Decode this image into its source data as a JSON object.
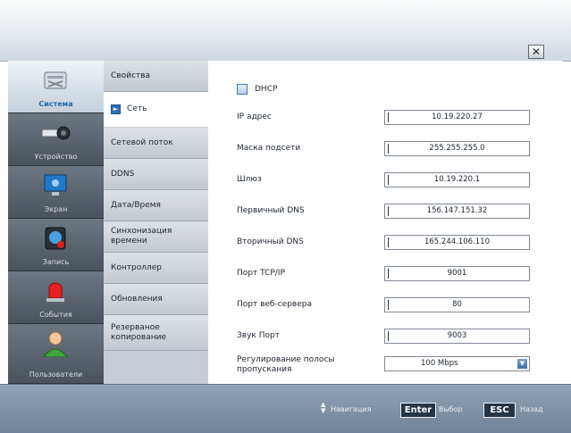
{
  "window": {
    "close_glyph": "✕"
  },
  "sidebar": {
    "items": [
      {
        "label": "Система",
        "icon": "system-icon",
        "active": true
      },
      {
        "label": "Устройство",
        "icon": "device-icon",
        "active": false
      },
      {
        "label": "Экран",
        "icon": "monitor-icon",
        "active": false
      },
      {
        "label": "Запись",
        "icon": "record-icon",
        "active": false
      },
      {
        "label": "События",
        "icon": "alarm-icon",
        "active": false
      },
      {
        "label": "Пользователи",
        "icon": "user-icon",
        "active": false
      }
    ]
  },
  "subnav": {
    "items": [
      {
        "label": "Свойства",
        "active": false
      },
      {
        "label": "Сеть",
        "active": true
      },
      {
        "label": "Сетевой поток",
        "active": false
      },
      {
        "label": "DDNS",
        "active": false
      },
      {
        "label": "Дата/Время",
        "active": false
      },
      {
        "label": "Синхонизация времени",
        "active": false
      },
      {
        "label": "Контроллер",
        "active": false
      },
      {
        "label": "Обновления",
        "active": false
      },
      {
        "label": "Резерваное копирование",
        "active": false
      }
    ]
  },
  "network": {
    "dhcp_label": "DHCP",
    "dhcp_checked": false,
    "rows": [
      {
        "label": "IP адрес",
        "value": "10.19.220.27"
      },
      {
        "label": "Маска подсети",
        "value": "255.255.255.0"
      },
      {
        "label": "Шлюз",
        "value": "10.19.220.1"
      },
      {
        "label": "Первичный DNS",
        "value": "156.147.151.32"
      },
      {
        "label": "Вторичный DNS",
        "value": "165.244.106.110"
      },
      {
        "label": "Порт TCP/IP",
        "value": "9001"
      },
      {
        "label": "Порт веб-сервера",
        "value": "80"
      },
      {
        "label": "Звук Порт",
        "value": "9003"
      }
    ],
    "bandwidth": {
      "label": "Регулирование полосы пропускания",
      "value": "100 Mbps"
    }
  },
  "footer": {
    "nav_text": "Навигация",
    "enter_key": "Enter",
    "select_text": "Выбор",
    "esc_key": "ESC",
    "back_text": "Назад"
  }
}
